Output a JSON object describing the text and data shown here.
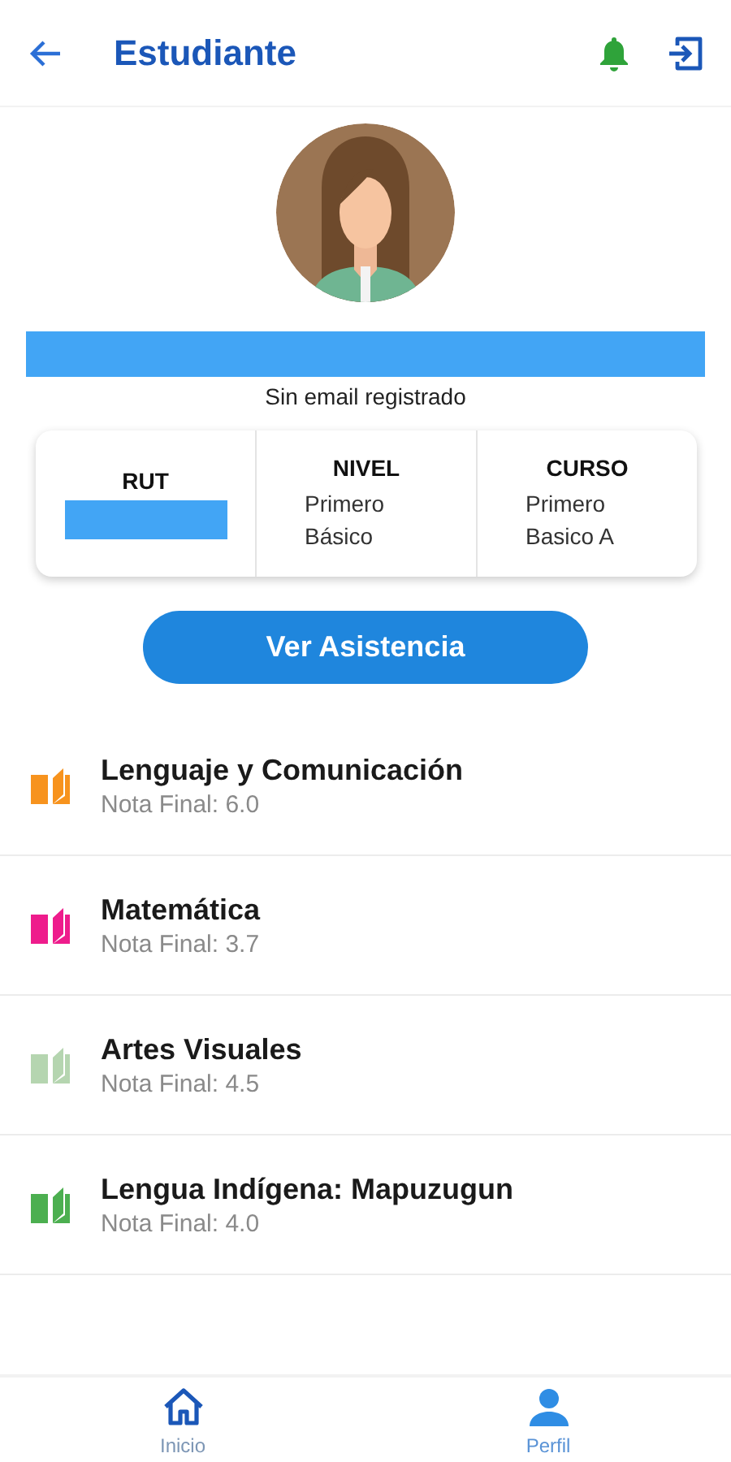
{
  "header": {
    "title": "Estudiante"
  },
  "profile": {
    "email": "Sin email registrado"
  },
  "info_card": [
    {
      "label": "RUT",
      "value_redacted": true
    },
    {
      "label": "NIVEL",
      "value": "Primero Básico",
      "value_redacted": false
    },
    {
      "label": "CURSO",
      "value": "Primero Basico A",
      "value_redacted": false
    }
  ],
  "attendance_button": {
    "label": "Ver Asistencia"
  },
  "subjects": [
    {
      "name": "Lenguaje y Comunicación",
      "grade": "Nota Final: 6.0",
      "color": "#f7931e"
    },
    {
      "name": "Matemática",
      "grade": "Nota Final: 3.7",
      "color": "#ee1c8c"
    },
    {
      "name": "Artes Visuales",
      "grade": "Nota Final: 4.5",
      "color": "#b5d5b0"
    },
    {
      "name": "Lengua Indígena: Mapuzugun",
      "grade": "Nota Final: 4.0",
      "color": "#4caf50"
    }
  ],
  "bottom_nav": [
    {
      "label": "Inicio",
      "kind": "home",
      "selected": false
    },
    {
      "label": "Perfil",
      "kind": "profile",
      "selected": true
    }
  ]
}
